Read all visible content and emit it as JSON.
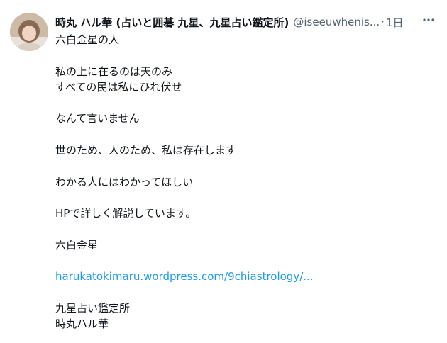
{
  "tweet": {
    "display_name": "時丸 ハル華 (占いと囲碁 九星、九星占い鑑定所)",
    "handle": "@iseeuwhenis...",
    "separator": "·",
    "time": "1日",
    "avatar_icon": "user-avatar-photo",
    "more_icon": "more-horizontal-icon",
    "body": {
      "l1": "六白金星の人",
      "l2": "私の上に在るのは天のみ",
      "l3": "すべての民は私にひれ伏せ",
      "l4": "なんて言いません",
      "l5": "世のため、人のため、私は存在します",
      "l6": "わかる人にはわかってほしい",
      "l7": "HPで詳しく解説しています。",
      "l8": "六白金星",
      "link": "harukatokimaru.wordpress.com/9chiastrology/...",
      "l9": "九星占い鑑定所",
      "l10": "時丸ハル華"
    }
  },
  "colors": {
    "text": "#0f1419",
    "secondary": "#536471",
    "link": "#1d9bf0"
  }
}
